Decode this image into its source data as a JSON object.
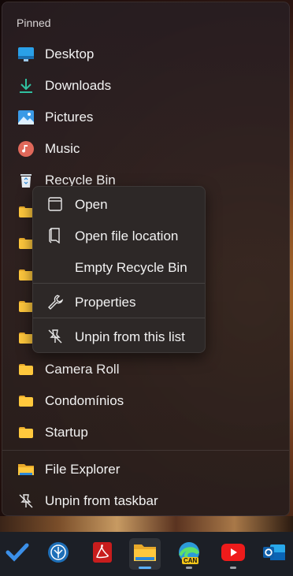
{
  "jumplist": {
    "section": "Pinned",
    "pinned": [
      {
        "label": "Desktop",
        "icon": "desktop-icon"
      },
      {
        "label": "Downloads",
        "icon": "downloads-icon"
      },
      {
        "label": "Pictures",
        "icon": "pictures-icon"
      },
      {
        "label": "Music",
        "icon": "music-icon"
      },
      {
        "label": "Recycle Bin",
        "icon": "recycle-bin-icon"
      },
      {
        "label": "",
        "icon": "folder-icon"
      },
      {
        "label": "",
        "icon": "folder-icon"
      },
      {
        "label": "",
        "icon": "folder-icon"
      },
      {
        "label": "",
        "icon": "folder-icon"
      },
      {
        "label": "",
        "icon": "folder-icon"
      },
      {
        "label": "Camera Roll",
        "icon": "folder-icon"
      },
      {
        "label": "Condomínios",
        "icon": "folder-icon"
      },
      {
        "label": "Startup",
        "icon": "folder-icon"
      }
    ],
    "tasks": [
      {
        "label": "File Explorer",
        "icon": "file-explorer-icon"
      },
      {
        "label": "Unpin from taskbar",
        "icon": "unpin-icon"
      }
    ]
  },
  "context_menu": {
    "items": [
      {
        "label": "Open",
        "icon": "window-icon"
      },
      {
        "label": "Open file location",
        "icon": "file-location-icon"
      },
      {
        "label": "Empty Recycle Bin",
        "icon": ""
      },
      {
        "label": "Properties",
        "icon": "wrench-icon"
      },
      {
        "label": "Unpin from this list",
        "icon": "unpin-icon"
      }
    ]
  },
  "taskbar": {
    "apps": [
      {
        "name": "todo-icon"
      },
      {
        "name": "app-icon"
      },
      {
        "name": "pdf-reader-icon"
      },
      {
        "name": "file-explorer-icon",
        "active": true
      },
      {
        "name": "edge-canary-icon",
        "badge": "CAN"
      },
      {
        "name": "youtube-icon"
      },
      {
        "name": "outlook-icon"
      }
    ]
  },
  "colors": {
    "accent": "#5ab0ff",
    "folder": "#ffc83d"
  }
}
